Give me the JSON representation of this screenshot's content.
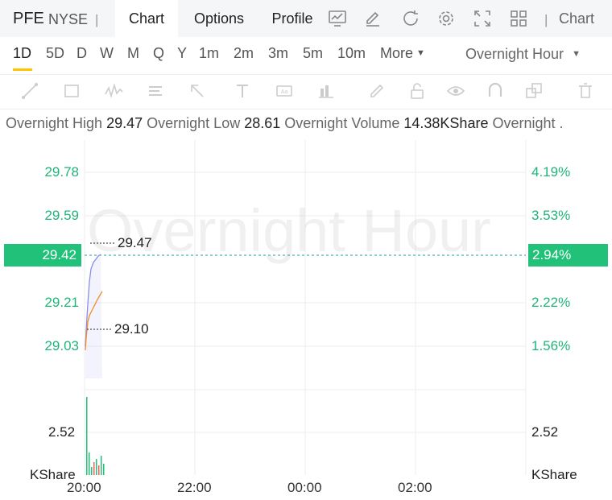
{
  "header": {
    "ticker": "PFE",
    "exchange": "NYSE",
    "separator": "|",
    "tabs": [
      {
        "label": "Chart",
        "active": true
      },
      {
        "label": "Options",
        "active": false
      },
      {
        "label": "Profile",
        "active": false
      }
    ],
    "icons": [
      "chart-monitor-icon",
      "edit-pen-icon",
      "refresh-icon",
      "settings-gear-icon",
      "expand-icon",
      "grid-layout-icon"
    ],
    "overflow_tab": "Chart"
  },
  "periods": {
    "items": [
      "1D",
      "5D",
      "D",
      "W",
      "M",
      "Q",
      "Y",
      "1m",
      "2m",
      "3m",
      "5m",
      "10m"
    ],
    "active": "1D",
    "more_label": "More",
    "session_select": "Overnight Hour"
  },
  "toolbar": {
    "icons": [
      "trend-line-icon",
      "rectangle-icon",
      "wave-icon",
      "text-list-icon",
      "arrow-icon",
      "text-tool-icon",
      "label-icon",
      "bar-measure-icon",
      "pencil-icon",
      "lock-icon",
      "eye-icon",
      "magnet-icon",
      "layers-icon",
      "trash-icon"
    ]
  },
  "stats": {
    "high_label": "Overnight High",
    "high_value": "29.47",
    "low_label": "Overnight Low",
    "low_value": "28.61",
    "volume_label": "Overnight Volume",
    "volume_value": "14.38KShare",
    "extra_label": "Overnight ."
  },
  "chart": {
    "watermark": "Overnight Hour",
    "price_axis": [
      "29.78",
      "29.59",
      "29.21",
      "29.03"
    ],
    "pct_axis": [
      "4.19%",
      "3.53%",
      "2.22%",
      "1.56%"
    ],
    "current_price": "29.42",
    "current_pct": "2.94%",
    "high_annotation": "29.47",
    "low_annotation": "29.10",
    "volume_axis_left": "2.52",
    "volume_axis_right": "2.52",
    "volume_unit_left": "KShare",
    "volume_unit_right": "KShare",
    "time_axis": [
      "20:00",
      "22:00",
      "00:00",
      "02:00"
    ],
    "colors": {
      "up": "#22c17a",
      "price_line": "#8a8ee8",
      "avg_line": "#f08c2a",
      "grid": "#eeeeee"
    }
  },
  "chart_data": {
    "type": "line",
    "series": [],
    "x": [
      "20:00",
      "20:05",
      "20:10",
      "20:15",
      "20:20"
    ],
    "price": [
      29.1,
      29.38,
      29.44,
      29.43,
      29.47
    ],
    "avg": [
      29.05,
      29.14,
      29.19,
      29.21,
      29.26
    ],
    "ylim": [
      29.0,
      29.8
    ]
  }
}
